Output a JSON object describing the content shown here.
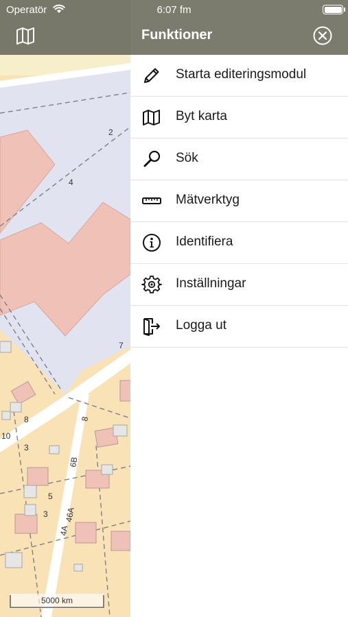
{
  "status_bar": {
    "carrier": "Operatör",
    "time": "6:07 fm"
  },
  "map": {
    "toolbar_icon": "map-icon",
    "scale_label": "5000 km",
    "lot_labels": [
      "2",
      "4",
      "7",
      "8",
      "10",
      "3",
      "5",
      "3",
      "6B",
      "46A",
      "4A",
      "8"
    ],
    "colors": {
      "road": "#ffffff",
      "residential": "#f8e2b6",
      "area": "#e2e3f1",
      "building": "#efc1b7"
    }
  },
  "panel": {
    "title": "Funktioner",
    "close_icon": "close-circle-icon",
    "items": [
      {
        "label": "Starta editeringsmodul",
        "icon": "pencil-icon"
      },
      {
        "label": "Byt karta",
        "icon": "map-icon"
      },
      {
        "label": "Sök",
        "icon": "search-icon"
      },
      {
        "label": "Mätverktyg",
        "icon": "ruler-icon"
      },
      {
        "label": "Identifiera",
        "icon": "info-icon"
      },
      {
        "label": "Inställningar",
        "icon": "gear-icon"
      },
      {
        "label": "Logga ut",
        "icon": "logout-icon"
      }
    ]
  }
}
